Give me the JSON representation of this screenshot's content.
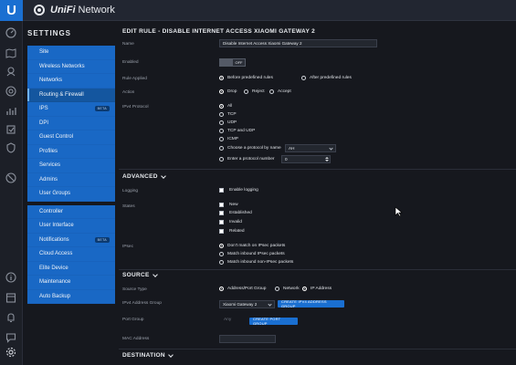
{
  "app": {
    "logo_letter": "U",
    "brand_bold": "UniFi",
    "brand_rest": " Network"
  },
  "iconbar": {
    "icons": [
      "dashboard-icon",
      "map-icon",
      "devices-icon",
      "clients-icon",
      "statistics-icon",
      "insights-icon",
      "security-icon",
      "events-icon"
    ],
    "bottom_icons": [
      "info-icon",
      "calendar-icon",
      "alerts-icon",
      "chat-icon",
      "settings-icon"
    ]
  },
  "settings": {
    "title": "SETTINGS",
    "group1": [
      {
        "label": "Site"
      },
      {
        "label": "Wireless Networks"
      },
      {
        "label": "Networks"
      },
      {
        "label": "Routing & Firewall",
        "active": true
      },
      {
        "label": "IPS",
        "badge": "BETA"
      },
      {
        "label": "DPI"
      },
      {
        "label": "Guest Control"
      },
      {
        "label": "Profiles"
      },
      {
        "label": "Services"
      },
      {
        "label": "Admins"
      },
      {
        "label": "User Groups"
      }
    ],
    "group2": [
      {
        "label": "Controller"
      },
      {
        "label": "User Interface"
      },
      {
        "label": "Notifications",
        "badge": "BETA"
      },
      {
        "label": "Cloud Access"
      },
      {
        "label": "Elite Device"
      },
      {
        "label": "Maintenance"
      },
      {
        "label": "Auto Backup"
      }
    ]
  },
  "form": {
    "title": "EDIT RULE - DISABLE INTERNET ACCESS XIAOMI GATEWAY 2",
    "name_label": "Name",
    "name_value": "Disable Internet Access Xiaomi Gateway 2",
    "enabled_label": "Enabled",
    "enabled_state": "OFF",
    "rule_applied_label": "Rule Applied",
    "rule_applied_options": [
      "Before predefined rules",
      "After predefined rules"
    ],
    "action_label": "Action",
    "action_options": [
      "Drop",
      "Reject",
      "Accept"
    ],
    "protocol_label": "IPv4 Protocol",
    "protocol_options": [
      "All",
      "TCP",
      "UDP",
      "TCP and UDP",
      "ICMP",
      "Choose a protocol by name",
      "Enter a protocol number"
    ],
    "protocol_name_value": "AH",
    "protocol_number_value": "0"
  },
  "advanced": {
    "title": "ADVANCED",
    "logging_label": "Logging",
    "logging_option": "Enable logging",
    "states_label": "States",
    "states_options": [
      "New",
      "Established",
      "Invalid",
      "Related"
    ],
    "ipsec_label": "IPsec",
    "ipsec_options": [
      "Don't match on IPsec packets",
      "Match inbound IPsec packets",
      "Match inbound non-IPsec packets"
    ]
  },
  "source": {
    "title": "SOURCE",
    "type_label": "Source Type",
    "type_options": [
      "Address/Port Group",
      "Network",
      "IP Address"
    ],
    "ipv4_group_label": "IPv4 Address Group",
    "ipv4_group_value": "Xiaomi Gateway 2",
    "create_ipv4_button": "CREATE IPV4 ADDRESS GROUP",
    "port_group_label": "Port Group",
    "port_group_value": "Any",
    "create_port_button": "CREATE PORT GROUP",
    "mac_label": "MAC Address"
  },
  "destination": {
    "title": "DESTINATION"
  },
  "colors": {
    "accent": "#1a6fd1",
    "menu_bg": "#1968c5",
    "page_bg": "#16181e"
  }
}
